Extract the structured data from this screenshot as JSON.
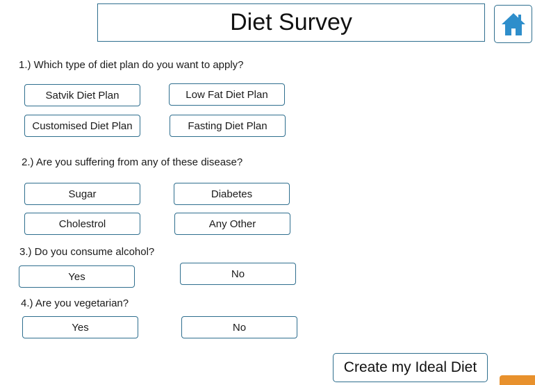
{
  "header": {
    "title": "Diet Survey",
    "home_icon": "home-icon",
    "accent_color": "#2e8ecb"
  },
  "questions": [
    {
      "text": "1.) Which type of diet plan do you want to apply?",
      "options": [
        "Satvik Diet Plan",
        "Low Fat Diet Plan",
        "Customised Diet Plan",
        "Fasting Diet Plan"
      ]
    },
    {
      "text": "2.) Are you suffering from any of these disease?",
      "options": [
        "Sugar",
        "Diabetes",
        "Cholestrol",
        "Any Other"
      ]
    },
    {
      "text": "3.) Do you consume alcohol?",
      "options": [
        "Yes",
        "No"
      ]
    },
    {
      "text": "4.) Are you vegetarian?",
      "options": [
        "Yes",
        "No"
      ]
    }
  ],
  "submit_label": "Create my Ideal Diet",
  "colors": {
    "border": "#2e6e8e",
    "corner_tab": "#e8912d"
  }
}
